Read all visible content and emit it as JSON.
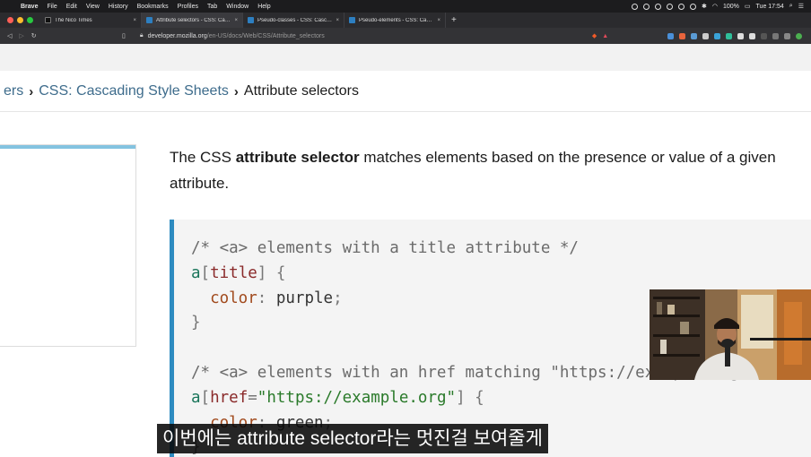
{
  "menubar": {
    "app_name": "Brave",
    "menus": [
      "File",
      "Edit",
      "View",
      "History",
      "Bookmarks",
      "Profiles",
      "Tab",
      "Window",
      "Help"
    ],
    "battery": "100%",
    "clock": "Tue 17:54"
  },
  "tabs": [
    {
      "label": "The Nico Times",
      "close": "×"
    },
    {
      "label": "Attribute selectors - CSS: Cascad",
      "close": "×"
    },
    {
      "label": "Pseudo-classes - CSS: Cascadin",
      "close": "×"
    },
    {
      "label": "Pseudo-elements - CSS: Cascad",
      "close": "×"
    }
  ],
  "new_tab": "+",
  "address": {
    "host": "developer.mozilla.org",
    "path": "/en-US/docs/Web/CSS/Attribute_selectors"
  },
  "breadcrumb": {
    "partial": "ers",
    "parent": "CSS: Cascading Style Sheets",
    "current": "Attribute selectors"
  },
  "intro": {
    "before": "The CSS ",
    "bold": "attribute selector",
    "after": " matches elements based on the presence or value of a given attribute."
  },
  "code": {
    "line1": "/* <a> elements with a title attribute */",
    "line2_sel": "a",
    "line2_attr": "title",
    "prop1": "color",
    "val1": "purple",
    "line5": "/* <a> elements with an href matching \"https://example.org\" */",
    "line6_sel": "a",
    "line6_attr": "href",
    "line6_str": "\"https://example.org\"",
    "prop2": "color",
    "val2": "green"
  },
  "subtitle": "이번에는 attribute selector라는 멋진걸 보여줄게",
  "colors": {
    "link": "#3e6c8c",
    "code_border": "#2d8bc0",
    "sidebar_accent": "#83c3e0"
  }
}
